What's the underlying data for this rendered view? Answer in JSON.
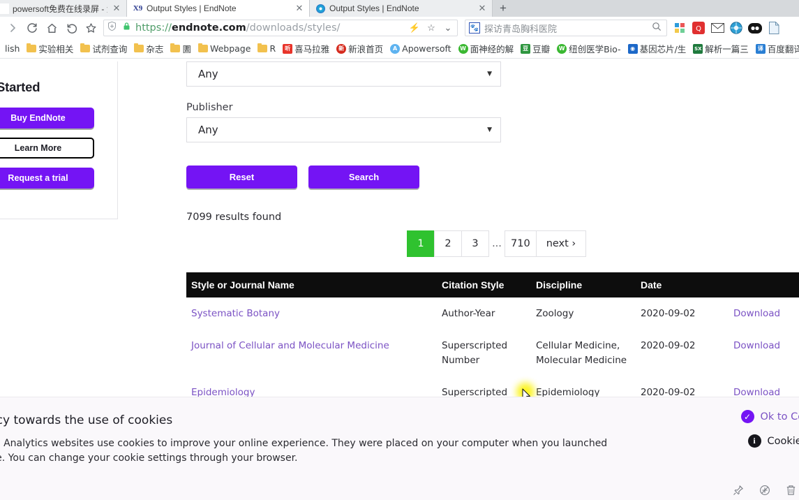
{
  "browser": {
    "tabs": [
      {
        "title": "powersoft免费在线录屏 - 免费",
        "favicon": "blank-favicon",
        "active": false
      },
      {
        "title": "Output Styles | EndNote",
        "favicon": "endnote-x9-favicon",
        "active": true
      },
      {
        "title": "Output Styles | EndNote",
        "favicon": "endnote-globe-favicon",
        "active": false
      }
    ],
    "new_tab_label": "+",
    "close_label": "✕",
    "nav": {
      "forward": "forward-arrow",
      "reload": "reload",
      "home": "home",
      "back": "back-arrow",
      "bookmark_star": "star"
    },
    "omnibox": {
      "scheme": "https://",
      "domain": "endnote.com",
      "path": "/downloads/styles/",
      "lightning": "⚡",
      "star": "☆",
      "chevron": "⌄"
    },
    "search": {
      "value": "探访青岛胸科医院",
      "engine": "baidu-icon",
      "go_icon": "search-icon"
    },
    "extensions": [
      "apps-grid-icon",
      "qq-icon",
      "mail-icon",
      "globe-icon",
      "panda-icon",
      "page-icon"
    ],
    "bookmarks": [
      {
        "label": "lish",
        "icon": "folder"
      },
      {
        "label": "实验相关",
        "icon": "folder"
      },
      {
        "label": "试剂查询",
        "icon": "folder"
      },
      {
        "label": "杂志",
        "icon": "folder"
      },
      {
        "label": "圕",
        "icon": "folder"
      },
      {
        "label": "Webpage",
        "icon": "folder"
      },
      {
        "label": "R",
        "icon": "folder"
      },
      {
        "label": "喜马拉雅",
        "icon": "ximalaya",
        "color": "#e8342a",
        "glyph": "听"
      },
      {
        "label": "新浪首页",
        "icon": "sina",
        "color": "#d52b1e",
        "glyph": "新"
      },
      {
        "label": "Apowersoft",
        "icon": "apowersoft",
        "color": "#5eb3f0",
        "glyph": "A"
      },
      {
        "label": "面神经的解",
        "icon": "wechat",
        "color": "#3bb832",
        "glyph": "W"
      },
      {
        "label": "豆瓣",
        "icon": "douban",
        "color": "#2e963f",
        "glyph": "豆"
      },
      {
        "label": "纽创医学Bio-",
        "icon": "wechat",
        "color": "#3bb832",
        "glyph": "W"
      },
      {
        "label": "基因芯片/生",
        "icon": "chip",
        "color": "#1c68c8",
        "glyph": "◉"
      },
      {
        "label": "解析一篇三",
        "icon": "sx",
        "color": "#1f7a3d",
        "glyph": "SX"
      },
      {
        "label": "百度翻译",
        "icon": "fanyi",
        "color": "#2a7fd4",
        "glyph": "译"
      }
    ]
  },
  "sidebar": {
    "heading": "et Started",
    "buttons": [
      {
        "label": "Buy EndNote",
        "style": "filled"
      },
      {
        "label": "Learn More",
        "style": "outline"
      },
      {
        "label": "Request a trial",
        "style": "filled"
      }
    ]
  },
  "form": {
    "top_select_value": "Any",
    "publisher_label": "Publisher",
    "publisher_value": "Any",
    "reset_label": "Reset",
    "search_label": "Search",
    "results_text": "7099 results found",
    "caret": "▼"
  },
  "pagination": {
    "pages": [
      "1",
      "2",
      "3"
    ],
    "gap": "...",
    "last": "710",
    "next": "next ›",
    "current": "1",
    "current_color": "#2fc22f"
  },
  "table": {
    "columns": [
      "Style or Journal Name",
      "Citation Style",
      "Discipline",
      "Date",
      ""
    ],
    "rows": [
      {
        "name": "Systematic Botany",
        "citation_style": "Author-Year",
        "discipline": "Zoology",
        "date": "2020-09-02",
        "action": "Download"
      },
      {
        "name": "Journal of Cellular and Molecular Medicine",
        "citation_style": "Superscripted Number",
        "discipline": "Cellular Medicine, Molecular Medicine",
        "date": "2020-09-02",
        "action": "Download"
      },
      {
        "name": "Epidemiology",
        "citation_style": "Superscripted Number",
        "discipline": "Epidemiology",
        "date": "2020-09-02",
        "action": "Download"
      }
    ]
  },
  "cookie_banner": {
    "title": "policy towards the use of cookies",
    "body": "rivate Analytics websites use cookies to improve your online experience. They were placed on your computer when you launched ebsite. You can change your cookie settings through your browser.",
    "ok_label": "Ok to Conti",
    "policy_label": "Cookie Po",
    "ok_icon": "check-circle-icon",
    "policy_icon": "info-circle-icon"
  },
  "status_icons": [
    "pin-icon",
    "circle-plus-icon",
    "trash-icon"
  ],
  "colors": {
    "purple": "#7414f4",
    "link_purple": "#7b52c4",
    "green_active": "#2fc22f",
    "table_header_bg": "#0d0d0d"
  }
}
